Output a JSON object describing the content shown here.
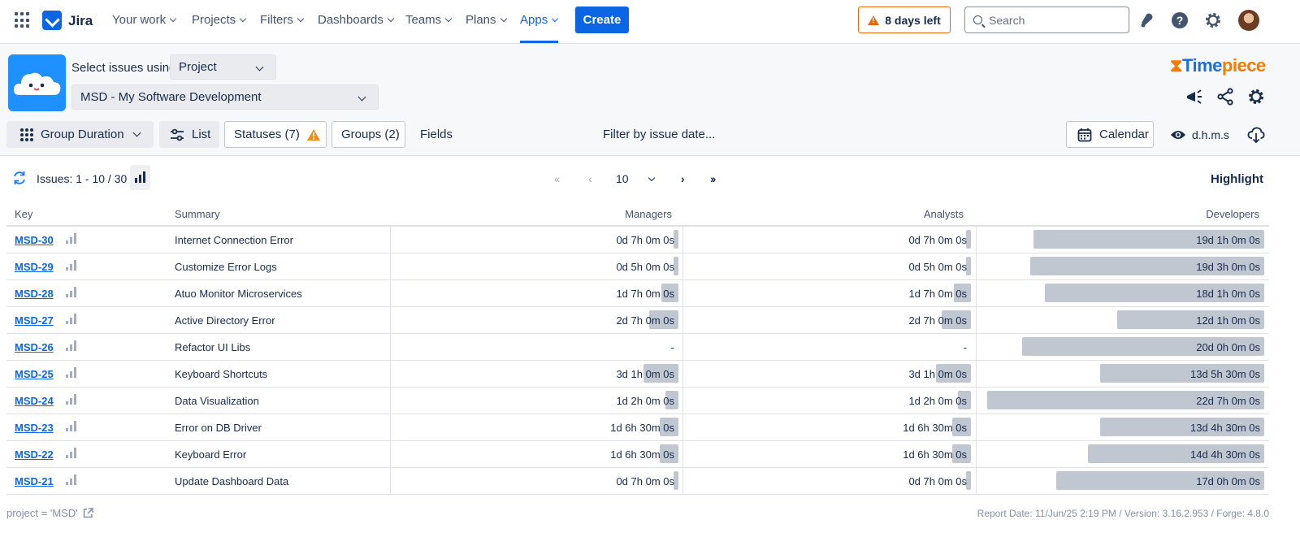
{
  "nav": {
    "brand": "Jira",
    "items": [
      {
        "label": "Your work",
        "active": false
      },
      {
        "label": "Projects",
        "active": false
      },
      {
        "label": "Filters",
        "active": false
      },
      {
        "label": "Dashboards",
        "active": false
      },
      {
        "label": "Teams",
        "active": false
      },
      {
        "label": "Plans",
        "active": false
      },
      {
        "label": "Apps",
        "active": true
      }
    ],
    "create_label": "Create",
    "trial_label": "8 days left",
    "search_placeholder": "Search",
    "icons": [
      "app-switcher-icon",
      "notifications-icon",
      "help-icon",
      "settings-icon",
      "avatar"
    ],
    "accent": "#0c66e4"
  },
  "timepiece": {
    "brand_time": "Time",
    "brand_piece": "piece",
    "select_label": "Select issues using",
    "select_mode": "Project",
    "project": "MSD - My Software Development"
  },
  "toolbar": {
    "group_duration": "Group Duration",
    "list": "List",
    "statuses": "Statuses (7)",
    "groups": "Groups (2)",
    "fields": "Fields",
    "filter_date": "Filter by issue date...",
    "calendar": "Calendar",
    "format": "d.h.m.s"
  },
  "issues": {
    "count_label": "Issues: 1 - 10 / 30",
    "page_size": "10",
    "highlight": "Highlight"
  },
  "table": {
    "headers": {
      "key": "Key",
      "summary": "Summary",
      "managers": "Managers",
      "analysts": "Analysts",
      "developers": "Developers"
    },
    "rows": [
      {
        "key": "MSD-30",
        "summary": "Internet Connection Error",
        "managers": "0d 7h 0m 0s",
        "analysts": "0d 7h 0m 0s",
        "developers": "19d 1h 0m 0s",
        "m_frac": 0.013,
        "a_frac": 0.013,
        "d_frac": 0.8
      },
      {
        "key": "MSD-29",
        "summary": "Customize Error Logs",
        "managers": "0d 5h 0m 0s",
        "analysts": "0d 5h 0m 0s",
        "developers": "19d 3h 0m 0s",
        "m_frac": 0.009,
        "a_frac": 0.009,
        "d_frac": 0.81
      },
      {
        "key": "MSD-28",
        "summary": "Atuo Monitor Microservices",
        "managers": "1d 7h 0m 0s",
        "analysts": "1d 7h 0m 0s",
        "developers": "18d 1h 0m 0s",
        "m_frac": 0.058,
        "a_frac": 0.058,
        "d_frac": 0.76
      },
      {
        "key": "MSD-27",
        "summary": "Active Directory Error",
        "managers": "2d 7h 0m 0s",
        "analysts": "2d 7h 0m 0s",
        "developers": "12d 1h 0m 0s",
        "m_frac": 0.1,
        "a_frac": 0.1,
        "d_frac": 0.51
      },
      {
        "key": "MSD-26",
        "summary": "Refactor UI Libs",
        "managers": "-",
        "analysts": "-",
        "developers": "20d 0h 0m 0s",
        "m_frac": 0,
        "a_frac": 0,
        "d_frac": 0.84
      },
      {
        "key": "MSD-25",
        "summary": "Keyboard Shortcuts",
        "managers": "3d 1h 0m 0s",
        "analysts": "3d 1h 0m 0s",
        "developers": "13d 5h 30m 0s",
        "m_frac": 0.12,
        "a_frac": 0.12,
        "d_frac": 0.57
      },
      {
        "key": "MSD-24",
        "summary": "Data Visualization",
        "managers": "1d 2h 0m 0s",
        "analysts": "1d 2h 0m 0s",
        "developers": "22d 7h 0m 0s",
        "m_frac": 0.045,
        "a_frac": 0.045,
        "d_frac": 0.96
      },
      {
        "key": "MSD-23",
        "summary": "Error on DB Driver",
        "managers": "1d 6h 30m 0s",
        "analysts": "1d 6h 30m 0s",
        "developers": "13d 4h 30m 0s",
        "m_frac": 0.065,
        "a_frac": 0.065,
        "d_frac": 0.57
      },
      {
        "key": "MSD-22",
        "summary": "Keyboard Error",
        "managers": "1d 6h 30m 0s",
        "analysts": "1d 6h 30m 0s",
        "developers": "14d 4h 30m 0s",
        "m_frac": 0.065,
        "a_frac": 0.065,
        "d_frac": 0.61
      },
      {
        "key": "MSD-21",
        "summary": "Update Dashboard Data",
        "managers": "0d 7h 0m 0s",
        "analysts": "0d 7h 0m 0s",
        "developers": "17d 0h 0m 0s",
        "m_frac": 0.013,
        "a_frac": 0.013,
        "d_frac": 0.72
      }
    ]
  },
  "footer": {
    "query": "project = 'MSD'",
    "report": "Report Date: 11/Jun/25 2:19 PM / Version: 3.16.2.953 / Forge: 4.8.0"
  }
}
